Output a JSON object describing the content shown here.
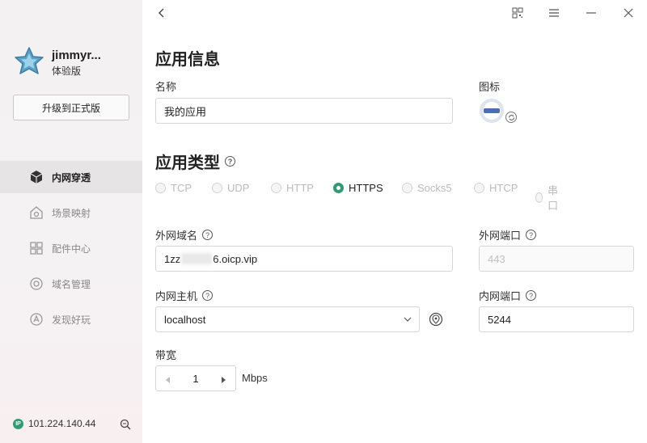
{
  "user": {
    "name": "jimmyr...",
    "tier": "体验版"
  },
  "sidebar": {
    "upgrade_label": "升级到正式版",
    "items": [
      {
        "label": "内网穿透",
        "icon": "box-icon",
        "active": true
      },
      {
        "label": "场景映射",
        "icon": "scene-icon",
        "active": false
      },
      {
        "label": "配件中心",
        "icon": "grid-icon",
        "active": false
      },
      {
        "label": "域名管理",
        "icon": "domain-icon",
        "active": false
      },
      {
        "label": "发现好玩",
        "icon": "discover-icon",
        "active": false
      }
    ],
    "ip_badge": "IP",
    "ip": "101.224.140.44"
  },
  "main": {
    "app_info_title": "应用信息",
    "name_label": "名称",
    "name_value": "我的应用",
    "icon_label": "图标",
    "app_type_title": "应用类型",
    "app_types": [
      {
        "label": "TCP",
        "checked": false
      },
      {
        "label": "UDP",
        "checked": false
      },
      {
        "label": "HTTP",
        "checked": false
      },
      {
        "label": "HTTPS",
        "checked": true
      },
      {
        "label": "Socks5",
        "checked": false
      },
      {
        "label": "HTCP",
        "checked": false
      },
      {
        "label": "串口",
        "checked": false
      }
    ],
    "external_domain_label": "外网域名",
    "external_domain_prefix": "1zz",
    "external_domain_suffix": "6.oicp.vip",
    "external_port_label": "外网端口",
    "external_port_value": "443",
    "internal_host_label": "内网主机",
    "internal_host_value": "localhost",
    "internal_port_label": "内网端口",
    "internal_port_value": "5244",
    "bandwidth_label": "带宽",
    "bandwidth_value": "1",
    "bandwidth_unit": "Mbps",
    "help_glyph": "?"
  },
  "colors": {
    "accent": "#2f9c74",
    "sidebar_active": "#e6e4e5"
  }
}
